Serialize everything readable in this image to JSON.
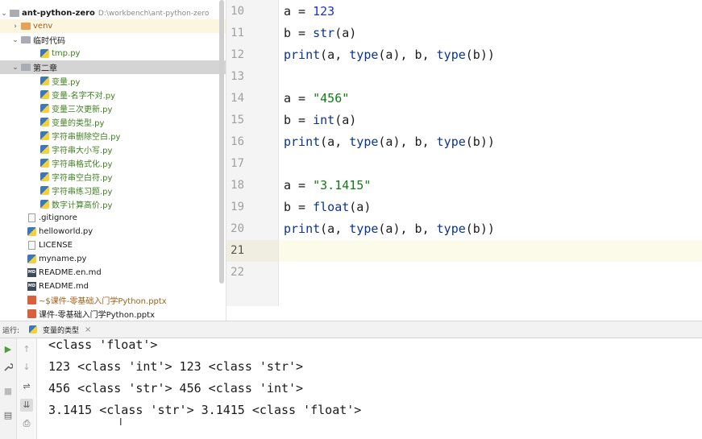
{
  "project": {
    "root_name": "ant-python-zero",
    "root_path": "D:\\workbench\\ant-python-zero",
    "items": [
      {
        "label": "venv"
      },
      {
        "label": "临时代码"
      },
      {
        "label": "tmp.py"
      },
      {
        "label": "第二章"
      },
      {
        "label": "变量.py"
      },
      {
        "label": "变量-名字不对.py"
      },
      {
        "label": "变量三次更新.py"
      },
      {
        "label": "变量的类型.py"
      },
      {
        "label": "字符串删除空白.py"
      },
      {
        "label": "字符串大小写.py"
      },
      {
        "label": "字符串格式化.py"
      },
      {
        "label": "字符串空白符.py"
      },
      {
        "label": "字符串练习题.py"
      },
      {
        "label": "数字计算高价.py"
      },
      {
        "label": ".gitignore"
      },
      {
        "label": "helloworld.py"
      },
      {
        "label": "LICENSE"
      },
      {
        "label": "myname.py"
      },
      {
        "label": "README.en.md"
      },
      {
        "label": "README.md"
      },
      {
        "label": "~$课件-零基础入门学Python.pptx"
      },
      {
        "label": "课件-零基础入门学Python.pptx"
      }
    ]
  },
  "editor": {
    "line_numbers": [
      "10",
      "11",
      "12",
      "13",
      "14",
      "15",
      "16",
      "17",
      "18",
      "19",
      "20",
      "21",
      "22"
    ],
    "current_line": "21",
    "lines": [
      {
        "a": "a = ",
        "b": "123",
        "c": ""
      },
      {
        "a": "b = ",
        "b": "str",
        "c": "(a)"
      },
      {
        "a": "print",
        "b": "(a, ",
        "c": "type",
        "d": "(a), b, ",
        "e": "type",
        "f": "(b))"
      },
      {
        "a": ""
      },
      {
        "a": "a = ",
        "b": "\"456\"",
        "c": ""
      },
      {
        "a": "b = ",
        "b": "int",
        "c": "(a)"
      },
      {
        "a": "print",
        "b": "(a, ",
        "c": "type",
        "d": "(a), b, ",
        "e": "type",
        "f": "(b))"
      },
      {
        "a": ""
      },
      {
        "a": "a = ",
        "b": "\"3.1415\"",
        "c": ""
      },
      {
        "a": "b = ",
        "b": "float",
        "c": "(a)"
      },
      {
        "a": "print",
        "b": "(a, ",
        "c": "type",
        "d": "(a), b, ",
        "e": "type",
        "f": "(b))"
      }
    ]
  },
  "run": {
    "label": "运行:",
    "tab": "变量的类型",
    "tab_close": "×",
    "output": [
      "<class 'float'>",
      "123 <class 'int'> 123 <class 'str'>",
      "456 <class 'str'> 456 <class 'int'>",
      "3.1415 <class 'str'> 3.1415 <class 'float'>"
    ]
  },
  "icons": {
    "chevron_right": "›",
    "chevron_down": "⌄",
    "run": "▶",
    "wrench": "🔧",
    "stop": "■",
    "layout": "▤",
    "up": "↑",
    "down": "↓",
    "wrap": "⇌",
    "sort": "⇊",
    "print": "⎙"
  },
  "colors": {
    "string": "#127a15",
    "number": "#1c2fd4",
    "builtin": "#0a3392",
    "run_green": "#4a9c3c"
  }
}
